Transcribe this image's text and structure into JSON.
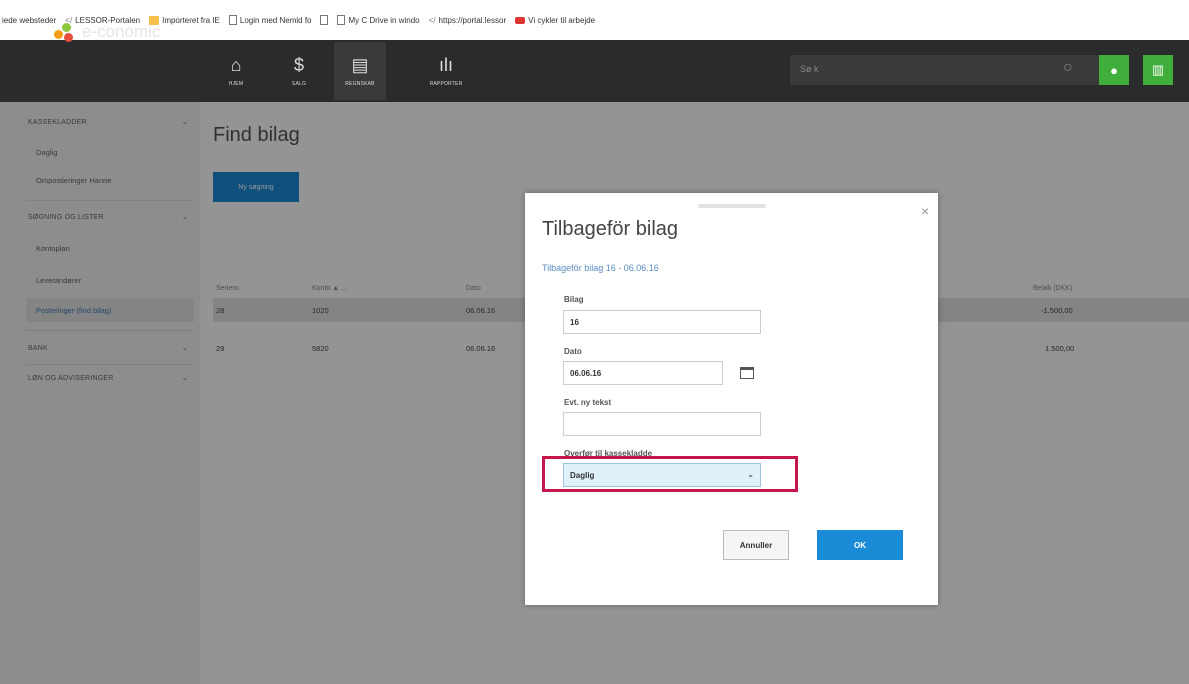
{
  "bookmarks": [
    {
      "label": "iede websteder",
      "icon": "none"
    },
    {
      "label": "LESSOR-Portalen",
      "icon": "code-icon"
    },
    {
      "label": "Importeret fra IE",
      "icon": "folder-icon"
    },
    {
      "label": "Login med Nemld fo",
      "icon": "page-icon"
    },
    {
      "label": "",
      "icon": "page-icon"
    },
    {
      "label": "My C Drive in windo",
      "icon": "page-icon"
    },
    {
      "label": "https://portal.lessor",
      "icon": "code-icon"
    },
    {
      "label": "Vi cykler til arbejde",
      "icon": "red-icon"
    }
  ],
  "brand": {
    "name": "e-conomic"
  },
  "nav": [
    {
      "label": "HJEM",
      "icon": "home-icon"
    },
    {
      "label": "SALG",
      "icon": "dollar-icon"
    },
    {
      "label": "REGNSKAB",
      "icon": "clipboard-icon"
    },
    {
      "label": "RAPPORTER",
      "icon": "bar-chart-icon"
    }
  ],
  "search": {
    "placeholder": "Sø k"
  },
  "sidebar": {
    "groups": [
      {
        "label": "KASSEKLADDER"
      },
      {
        "label": "SØGNING OG LISTER"
      },
      {
        "label": "BANK"
      },
      {
        "label": "LØN OG ADVISERINGER"
      }
    ],
    "items": [
      {
        "label": "Daglig"
      },
      {
        "label": "Ompostieringer Hanne"
      },
      {
        "label": "Kontoplan"
      },
      {
        "label": "Leverandører"
      },
      {
        "label": "Posteringer (find bilag)"
      }
    ]
  },
  "main": {
    "title": "Find bilag",
    "new_search_label": "Ny søgning",
    "table": {
      "columns": [
        "Serienr.",
        "Konto ▲ ...",
        "Dato",
        "Beløb (DKK)"
      ],
      "rows": [
        {
          "serienr": "28",
          "konto": "1020",
          "dato": "06.06.16",
          "belob": "-1.500,00"
        },
        {
          "serienr": "29",
          "konto": "5820",
          "dato": "06.06.16",
          "belob": "1.500,00"
        }
      ]
    }
  },
  "modal": {
    "title": "Tilbageför bilag",
    "subtitle": "Tilbageför bilag 16 - 06.06.16",
    "fields": {
      "bilag_label": "Bilag",
      "bilag_value": "16",
      "dato_label": "Dato",
      "dato_value": "06.06.16",
      "tekst_label": "Evt. ny tekst",
      "tekst_value": "",
      "kladde_label": "Overfør til kassekladde",
      "kladde_value": "Daglig"
    },
    "cancel_label": "Annuller",
    "ok_label": "OK",
    "close_glyph": "×"
  },
  "colors": {
    "accent_blue": "#1a8bd6",
    "brand_green": "#3fae3a",
    "highlight_red": "#c4164a",
    "select_bg": "#dff2fa"
  }
}
